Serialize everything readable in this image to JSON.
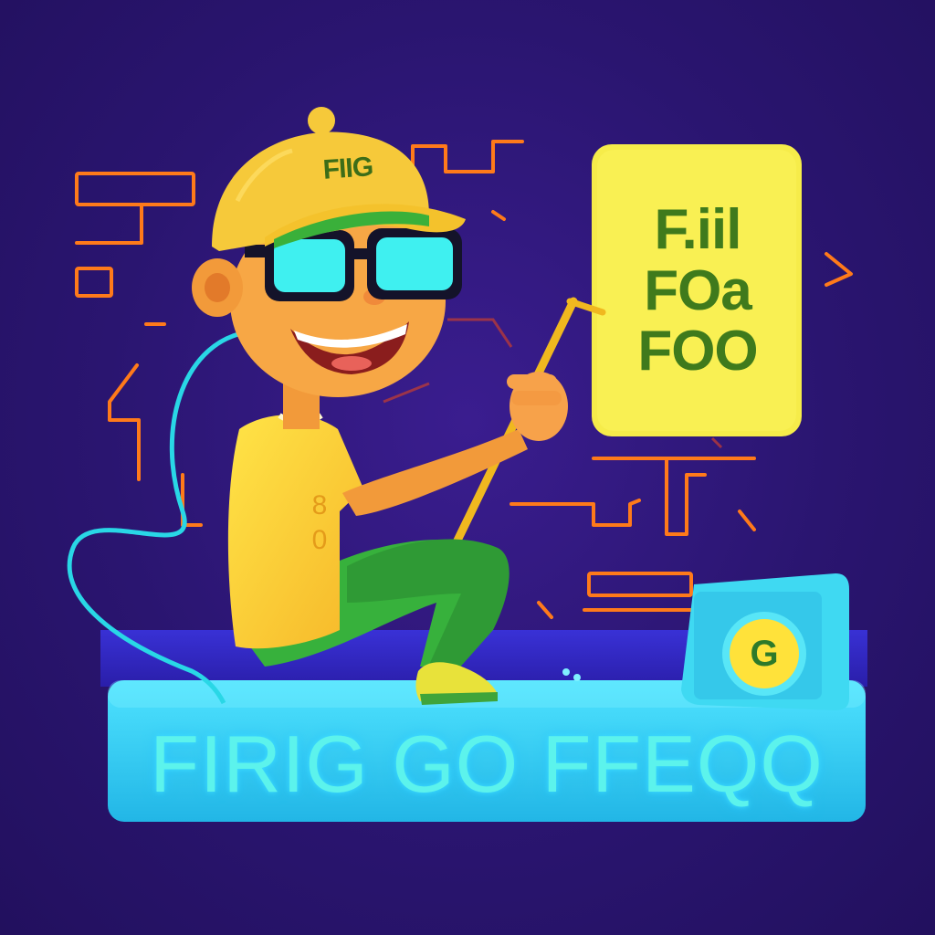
{
  "cap_text": "FIIG",
  "sign_lines": [
    "F.iil",
    "FOa",
    "FOO"
  ],
  "shirt_lines": [
    "8",
    "0"
  ],
  "banner_text": "FIRIG GO FFEQQ",
  "badge_text": "G",
  "colors": {
    "background": "#2a1570",
    "sign": "#f6ec4a",
    "banner": "#35d3f0",
    "circuit": "#ff7a1a",
    "pants": "#3ab03a"
  }
}
